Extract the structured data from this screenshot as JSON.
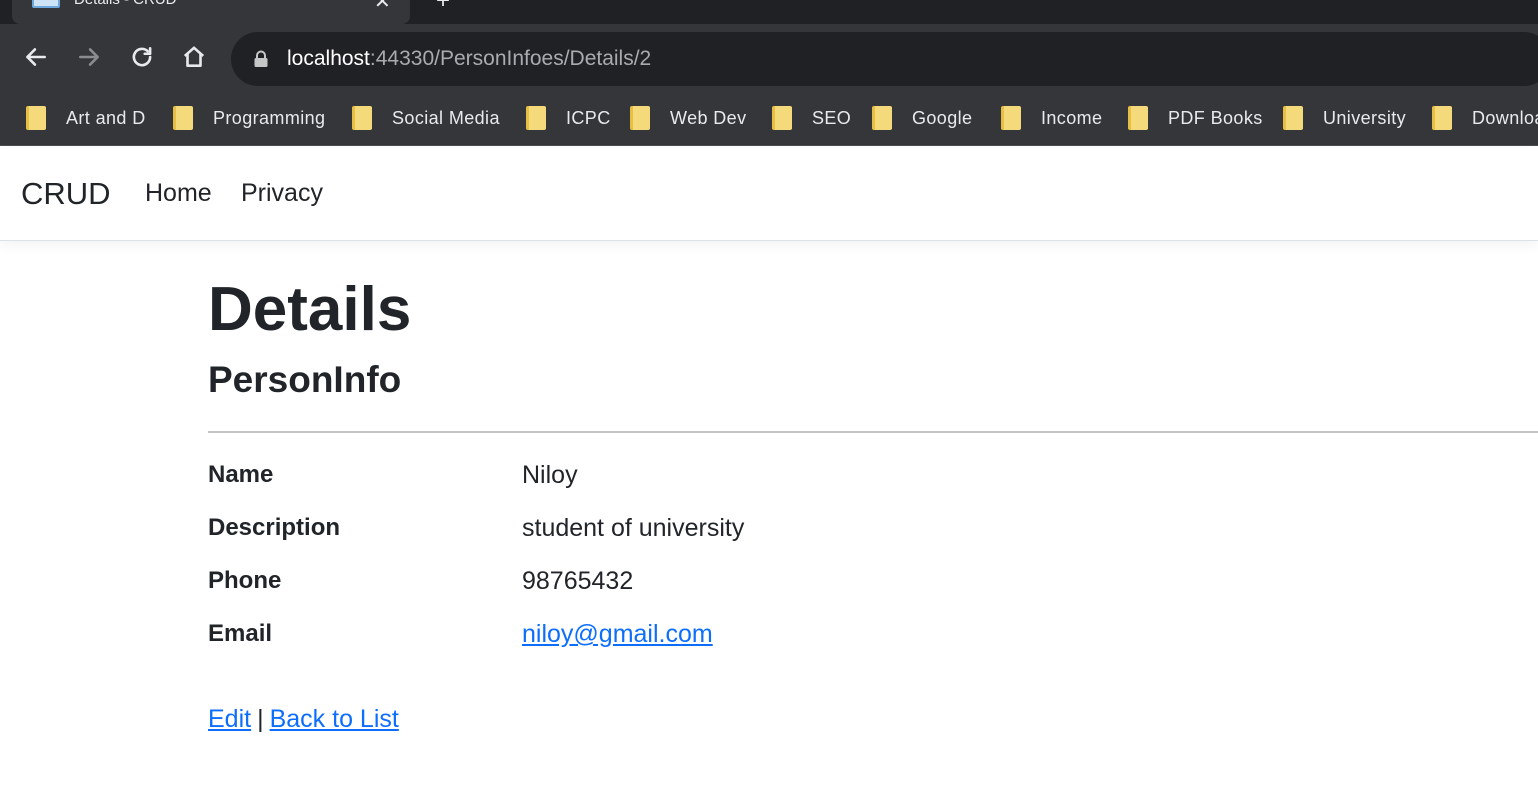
{
  "browser": {
    "tab_title": "Details - CRUD",
    "url_host": "localhost",
    "url_rest": ":44330/PersonInfoes/Details/2",
    "bookmarks": [
      "Art and D",
      "Programming",
      "Social Media",
      "ICPC",
      "Web Dev",
      "SEO",
      "Google",
      "Income",
      "PDF Books",
      "University",
      "Downloa"
    ]
  },
  "navbar": {
    "brand": "CRUD",
    "links": [
      "Home",
      "Privacy"
    ]
  },
  "page": {
    "title": "Details",
    "subtitle": "PersonInfo",
    "fields": [
      {
        "label": "Name",
        "value": "Niloy"
      },
      {
        "label": "Description",
        "value": "student of university"
      },
      {
        "label": "Phone",
        "value": "98765432"
      },
      {
        "label": "Email",
        "value": "niloy@gmail.com"
      }
    ],
    "edit_label": "Edit",
    "separator": "|",
    "back_label": "Back to List"
  }
}
